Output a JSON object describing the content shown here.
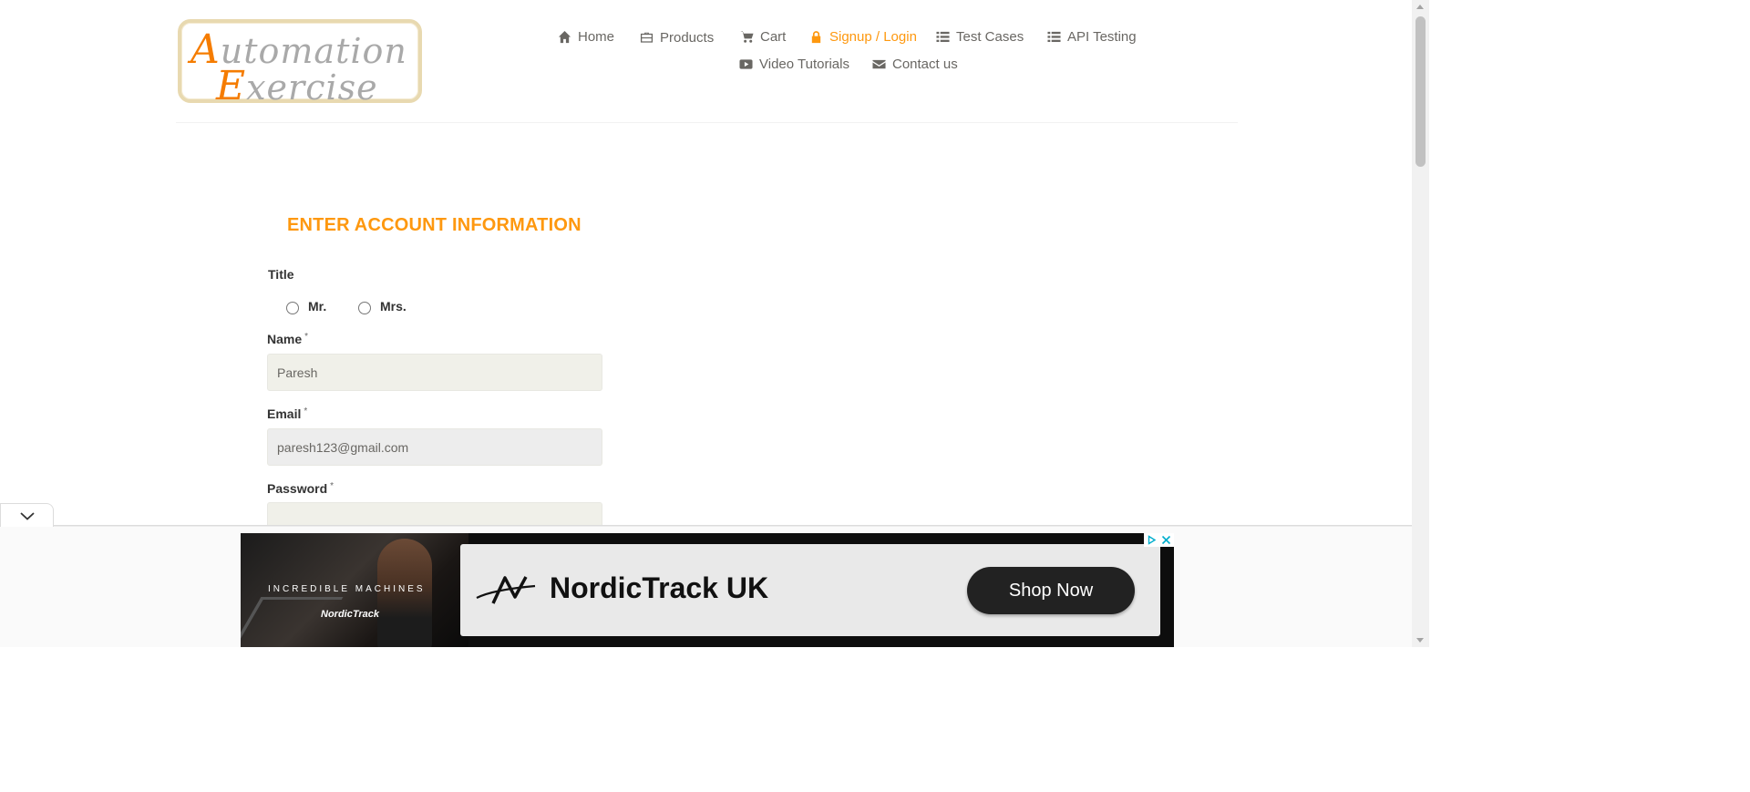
{
  "logo": {
    "line1_cap": "A",
    "line1_rest": "utomation",
    "line2_cap": "E",
    "line2_rest": "xercise"
  },
  "nav": {
    "items": [
      {
        "label": "Home",
        "icon": "home-icon"
      },
      {
        "label": "Products",
        "icon": "briefcase-icon"
      },
      {
        "label": "Cart",
        "icon": "cart-icon"
      },
      {
        "label": "Signup / Login",
        "icon": "lock-icon",
        "active": true
      },
      {
        "label": "Test Cases",
        "icon": "list-icon"
      },
      {
        "label": "API Testing",
        "icon": "list-icon"
      },
      {
        "label": "Video Tutorials",
        "icon": "youtube-icon"
      },
      {
        "label": "Contact us",
        "icon": "envelope-icon"
      }
    ]
  },
  "form": {
    "title": "ENTER ACCOUNT INFORMATION",
    "title_label": "Title",
    "title_options": [
      "Mr.",
      "Mrs."
    ],
    "name_label": "Name",
    "name_value": "Paresh",
    "email_label": "Email",
    "email_value": "paresh123@gmail.com",
    "password_label": "Password",
    "password_value": "",
    "required_mark": "*"
  },
  "ad": {
    "tagline": "INCREDIBLE MACHINES",
    "small_brand": "NordicTrack",
    "brand": "NordicTrack UK",
    "cta": "Shop Now"
  },
  "colors": {
    "accent": "#fe980f",
    "text": "#696763",
    "input_bg": "#f0f0e9"
  }
}
